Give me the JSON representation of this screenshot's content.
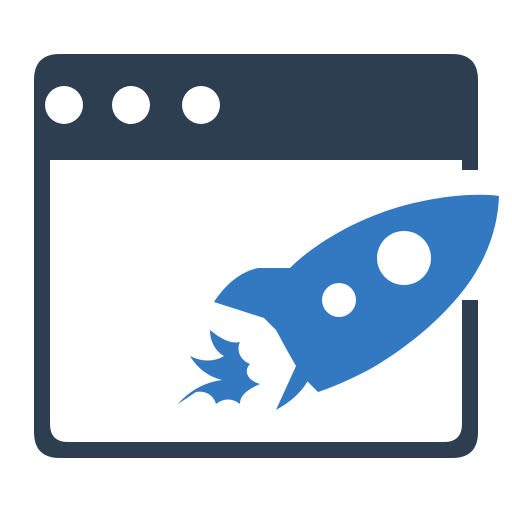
{
  "icon": {
    "name": "browser-rocket-icon",
    "parts": [
      "browser-window-icon",
      "window-control-dot-icon",
      "window-tab-icon",
      "rocket-icon",
      "rocket-window-icon",
      "flame-icon"
    ]
  },
  "colors": {
    "frame": "#2d3e50",
    "accent": "#3279c1",
    "background": "#ffffff"
  }
}
